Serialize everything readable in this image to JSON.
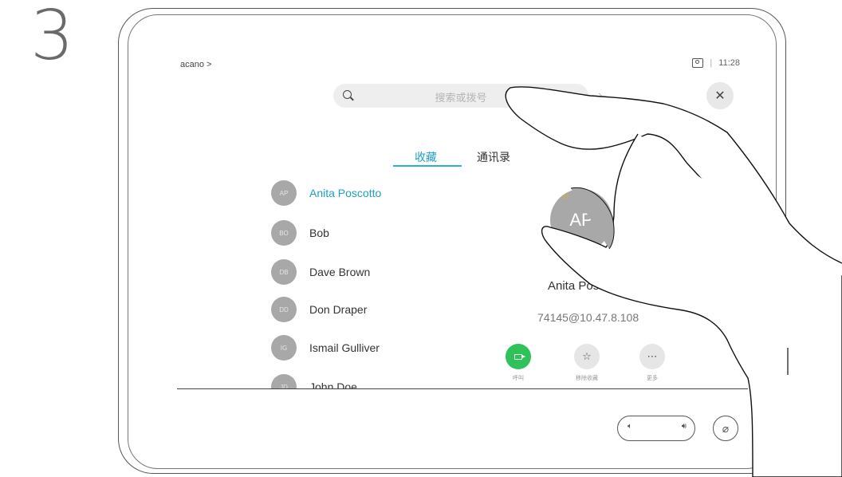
{
  "step": "3",
  "header": {
    "breadcrumb": "acano >",
    "time": "11:28",
    "separator": "|"
  },
  "search": {
    "placeholder": "搜索或拨号"
  },
  "tabs": [
    {
      "label": "收藏"
    },
    {
      "label": "通讯录"
    }
  ],
  "contacts": [
    {
      "initials": "AP",
      "name": "Anita Poscotto"
    },
    {
      "initials": "BO",
      "name": "Bob"
    },
    {
      "initials": "DB",
      "name": "Dave Brown"
    },
    {
      "initials": "DD",
      "name": "Don Draper"
    },
    {
      "initials": "IG",
      "name": "Ismail Gulliver"
    },
    {
      "initials": "JD",
      "name": "John Doe"
    }
  ],
  "detail": {
    "initials": "AP",
    "name": "Anita Pos",
    "uri": "74145@10.47.8.108"
  },
  "actions": [
    {
      "label": "呼叫",
      "icon": "video-camera-icon"
    },
    {
      "label": "移除收藏",
      "icon": "star-icon"
    },
    {
      "label": "更多",
      "icon": "more-icon"
    }
  ],
  "colors": {
    "accent": "#1e9fc4",
    "call": "#2fc25b",
    "favorite": "#f0b400"
  }
}
